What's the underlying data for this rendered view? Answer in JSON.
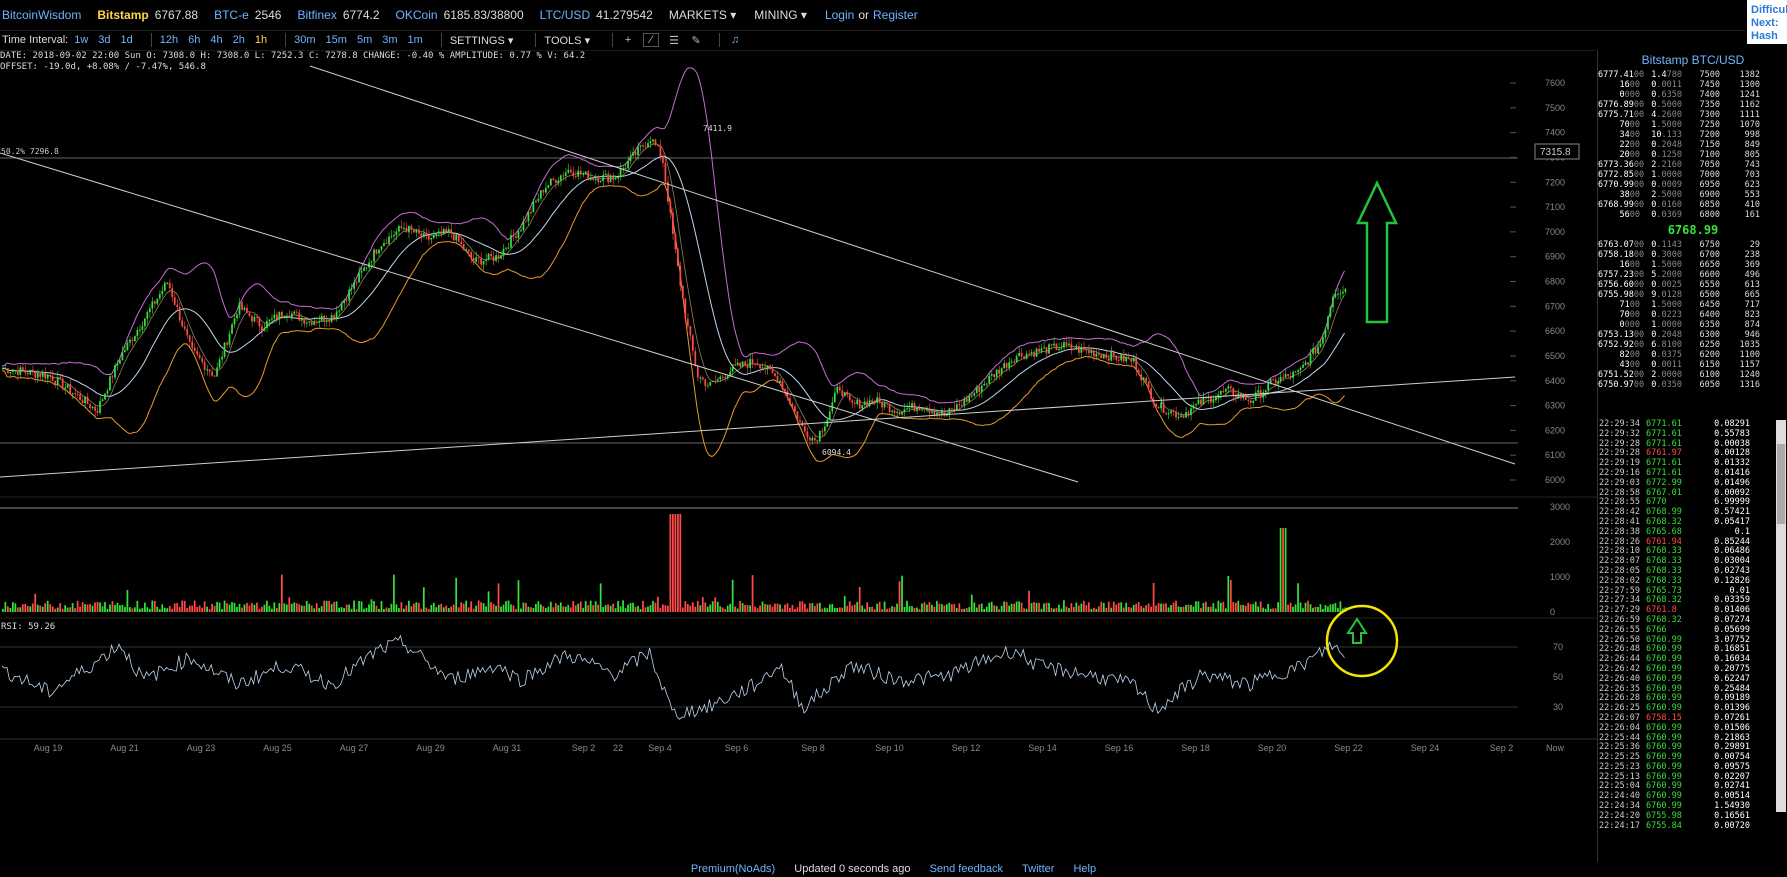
{
  "topbar": {
    "logo": "BitcoinWisdom",
    "exchanges": [
      {
        "name": "Bitstamp",
        "price": "6767.88",
        "active": true
      },
      {
        "name": "BTC-e",
        "price": "2546",
        "active": false
      },
      {
        "name": "Bitfinex",
        "price": "6774.2",
        "active": false
      },
      {
        "name": "OKCoin",
        "price": "6185.83/38800",
        "active": false
      },
      {
        "name": "LTC/USD",
        "price": "41.279542",
        "active": false
      }
    ],
    "markets_label": "MARKETS",
    "mining_label": "MINING",
    "login_label": "Login",
    "or_label": "or",
    "register_label": "Register",
    "difficulty_lines": [
      "Difficul",
      "Next:",
      "Hash R"
    ]
  },
  "toolbar": {
    "interval_label": "Time Interval:",
    "intervals": [
      "1w",
      "3d",
      "1d",
      "12h",
      "6h",
      "4h",
      "2h",
      "1h",
      "30m",
      "15m",
      "5m",
      "3m",
      "1m"
    ],
    "active_interval": "1h",
    "settings_label": "SETTINGS",
    "tools_label": "TOOLS"
  },
  "ohlc": {
    "line1": "DATE: 2018-09-02 22:00 Sun    O: 7308.0    H: 7308.0    L: 7252.3    C: 7278.8    CHANGE: -0.40 %    AMPLITUDE: 0.77 %    V: 64.2",
    "line2": "OFFSET: -19.0d, +8.08% / -7.47%, 546.8"
  },
  "chart_data": {
    "type": "candlestick",
    "pair": "Bitstamp BTC/USD",
    "price_axis": {
      "min": 6000,
      "max": 7600,
      "ticks": [
        "7600",
        "7500",
        "7400",
        "7300",
        "7200",
        "7100",
        "7000",
        "6900",
        "6800",
        "6700",
        "6600",
        "6500",
        "6400",
        "6300",
        "6200",
        "6100",
        "6000"
      ]
    },
    "volume_axis": {
      "ticks": [
        "3000",
        "2000",
        "1000",
        "0"
      ]
    },
    "rsi_axis": {
      "ticks": [
        "70",
        "50",
        "30"
      ]
    },
    "rsi_label": "RSI: 59.26",
    "x_labels": [
      "Aug 19",
      "Aug 21",
      "Aug 23",
      "Aug 25",
      "Aug 27",
      "Aug 29",
      "Aug 31",
      "Sep 2",
      "22",
      "Sep 4",
      "Sep 6",
      "Sep 8",
      "Sep 10",
      "Sep 12",
      "Sep 14",
      "Sep 16",
      "Sep 18",
      "Sep 20",
      "Sep 22",
      "Sep 24",
      "Sep 2",
      "Now"
    ],
    "current_price_tag": "7315.8",
    "left_level_label": "50.2% 7296.8",
    "high_label": "7411.9",
    "low_label": "6094.4",
    "close_keypoints": [
      {
        "t": 0,
        "p": 6450
      },
      {
        "t": 4,
        "p": 6420
      },
      {
        "t": 8,
        "p": 6280
      },
      {
        "t": 10,
        "p": 6500
      },
      {
        "t": 12,
        "p": 6650
      },
      {
        "t": 14,
        "p": 6800
      },
      {
        "t": 16,
        "p": 6520
      },
      {
        "t": 18,
        "p": 6420
      },
      {
        "t": 20,
        "p": 6700
      },
      {
        "t": 22,
        "p": 6620
      },
      {
        "t": 24,
        "p": 6680
      },
      {
        "t": 26,
        "p": 6640
      },
      {
        "t": 28,
        "p": 6660
      },
      {
        "t": 30,
        "p": 6800
      },
      {
        "t": 32,
        "p": 6950
      },
      {
        "t": 34,
        "p": 7020
      },
      {
        "t": 36,
        "p": 6970
      },
      {
        "t": 38,
        "p": 7000
      },
      {
        "t": 40,
        "p": 6880
      },
      {
        "t": 42,
        "p": 6900
      },
      {
        "t": 44,
        "p": 7020
      },
      {
        "t": 46,
        "p": 7180
      },
      {
        "t": 48,
        "p": 7250
      },
      {
        "t": 50,
        "p": 7220
      },
      {
        "t": 52,
        "p": 7220
      },
      {
        "t": 54,
        "p": 7330
      },
      {
        "t": 55,
        "p": 7380
      },
      {
        "t": 56,
        "p": 7300
      },
      {
        "t": 57,
        "p": 6950
      },
      {
        "t": 58,
        "p": 6650
      },
      {
        "t": 59,
        "p": 6420
      },
      {
        "t": 60,
        "p": 6380
      },
      {
        "t": 62,
        "p": 6450
      },
      {
        "t": 64,
        "p": 6480
      },
      {
        "t": 66,
        "p": 6400
      },
      {
        "t": 68,
        "p": 6200
      },
      {
        "t": 69,
        "p": 6160
      },
      {
        "t": 70,
        "p": 6250
      },
      {
        "t": 71,
        "p": 6380
      },
      {
        "t": 72,
        "p": 6300
      },
      {
        "t": 74,
        "p": 6320
      },
      {
        "t": 76,
        "p": 6280
      },
      {
        "t": 78,
        "p": 6300
      },
      {
        "t": 80,
        "p": 6260
      },
      {
        "t": 82,
        "p": 6330
      },
      {
        "t": 84,
        "p": 6420
      },
      {
        "t": 86,
        "p": 6500
      },
      {
        "t": 88,
        "p": 6520
      },
      {
        "t": 90,
        "p": 6540
      },
      {
        "t": 92,
        "p": 6520
      },
      {
        "t": 94,
        "p": 6500
      },
      {
        "t": 96,
        "p": 6480
      },
      {
        "t": 98,
        "p": 6300
      },
      {
        "t": 100,
        "p": 6260
      },
      {
        "t": 102,
        "p": 6320
      },
      {
        "t": 104,
        "p": 6360
      },
      {
        "t": 106,
        "p": 6320
      },
      {
        "t": 108,
        "p": 6400
      },
      {
        "t": 110,
        "p": 6430
      },
      {
        "t": 112,
        "p": 6560
      },
      {
        "t": 113,
        "p": 6760
      },
      {
        "t": 114,
        "p": 6770
      }
    ],
    "rsi_keypoints": [
      {
        "t": 0,
        "v": 55
      },
      {
        "t": 4,
        "v": 40
      },
      {
        "t": 8,
        "v": 60
      },
      {
        "t": 10,
        "v": 72
      },
      {
        "t": 12,
        "v": 48
      },
      {
        "t": 16,
        "v": 63
      },
      {
        "t": 20,
        "v": 45
      },
      {
        "t": 24,
        "v": 58
      },
      {
        "t": 28,
        "v": 45
      },
      {
        "t": 32,
        "v": 68
      },
      {
        "t": 34,
        "v": 73
      },
      {
        "t": 38,
        "v": 48
      },
      {
        "t": 42,
        "v": 58
      },
      {
        "t": 44,
        "v": 48
      },
      {
        "t": 48,
        "v": 65
      },
      {
        "t": 52,
        "v": 52
      },
      {
        "t": 55,
        "v": 66
      },
      {
        "t": 57,
        "v": 25
      },
      {
        "t": 60,
        "v": 30
      },
      {
        "t": 64,
        "v": 45
      },
      {
        "t": 66,
        "v": 58
      },
      {
        "t": 68,
        "v": 30
      },
      {
        "t": 70,
        "v": 42
      },
      {
        "t": 72,
        "v": 58
      },
      {
        "t": 76,
        "v": 48
      },
      {
        "t": 80,
        "v": 50
      },
      {
        "t": 84,
        "v": 63
      },
      {
        "t": 86,
        "v": 68
      },
      {
        "t": 88,
        "v": 57
      },
      {
        "t": 92,
        "v": 52
      },
      {
        "t": 96,
        "v": 45
      },
      {
        "t": 98,
        "v": 28
      },
      {
        "t": 100,
        "v": 40
      },
      {
        "t": 102,
        "v": 52
      },
      {
        "t": 104,
        "v": 48
      },
      {
        "t": 106,
        "v": 45
      },
      {
        "t": 108,
        "v": 52
      },
      {
        "t": 110,
        "v": 56
      },
      {
        "t": 112,
        "v": 66
      },
      {
        "t": 113,
        "v": 72
      },
      {
        "t": 114,
        "v": 62
      }
    ]
  },
  "orderbook": {
    "title": "Bitstamp BTC/USD",
    "asks": [
      {
        "price_main": "6777.41",
        "price_dim": "00",
        "amt_main": "1.4",
        "amt_dim": "780",
        "cum_price": "7500",
        "cum_amt": "1382"
      },
      {
        "price_main": "16",
        "price_dim": "00",
        "amt_main": "0",
        "amt_dim": ".0011",
        "cum_price": "7450",
        "cum_amt": "1300"
      },
      {
        "price_main": "0",
        "price_dim": "000",
        "amt_main": "0",
        "amt_dim": ".6350",
        "cum_price": "7400",
        "cum_amt": "1241"
      },
      {
        "price_main": "6776.89",
        "price_dim": "00",
        "amt_main": "0",
        "amt_dim": ".5000",
        "cum_price": "7350",
        "cum_amt": "1162"
      },
      {
        "price_main": "6775.71",
        "price_dim": "00",
        "amt_main": "4",
        "amt_dim": ".2600",
        "cum_price": "7300",
        "cum_amt": "1111"
      },
      {
        "price_main": "70",
        "price_dim": "00",
        "amt_main": "1",
        "amt_dim": ".5000",
        "cum_price": "7250",
        "cum_amt": "1070"
      },
      {
        "price_main": "34",
        "price_dim": "00",
        "amt_main": "10",
        "amt_dim": ".133",
        "cum_price": "7200",
        "cum_amt": "998"
      },
      {
        "price_main": "22",
        "price_dim": "00",
        "amt_main": "0",
        "amt_dim": ".2048",
        "cum_price": "7150",
        "cum_amt": "849"
      },
      {
        "price_main": "20",
        "price_dim": "00",
        "amt_main": "0",
        "amt_dim": ".1250",
        "cum_price": "7100",
        "cum_amt": "805"
      },
      {
        "price_main": "6773.36",
        "price_dim": "00",
        "amt_main": "2",
        "amt_dim": ".2160",
        "cum_price": "7050",
        "cum_amt": "743"
      },
      {
        "price_main": "6772.85",
        "price_dim": "00",
        "amt_main": "1",
        "amt_dim": ".0000",
        "cum_price": "7000",
        "cum_amt": "703"
      },
      {
        "price_main": "6770.99",
        "price_dim": "00",
        "amt_main": "0",
        "amt_dim": ".0009",
        "cum_price": "6950",
        "cum_amt": "623"
      },
      {
        "price_main": "38",
        "price_dim": "00",
        "amt_main": "2",
        "amt_dim": ".5000",
        "cum_price": "6900",
        "cum_amt": "553"
      },
      {
        "price_main": "6768.99",
        "price_dim": "00",
        "amt_main": "0",
        "amt_dim": ".0160",
        "cum_price": "6850",
        "cum_amt": "410"
      },
      {
        "price_main": "56",
        "price_dim": "00",
        "amt_main": "0",
        "amt_dim": ".0369",
        "cum_price": "6800",
        "cum_amt": "161"
      }
    ],
    "mid_price": "6768.99",
    "bids": [
      {
        "price_main": "6763.07",
        "price_dim": "00",
        "amt_main": "0",
        "amt_dim": ".1143",
        "cum_price": "6750",
        "cum_amt": "29"
      },
      {
        "price_main": "6758.18",
        "price_dim": "00",
        "amt_main": "0",
        "amt_dim": ".3000",
        "cum_price": "6700",
        "cum_amt": "238"
      },
      {
        "price_main": "16",
        "price_dim": "00",
        "amt_main": "1",
        "amt_dim": ".5000",
        "cum_price": "6650",
        "cum_amt": "369"
      },
      {
        "price_main": "6757.23",
        "price_dim": "00",
        "amt_main": "5",
        "amt_dim": ".2000",
        "cum_price": "6600",
        "cum_amt": "496"
      },
      {
        "price_main": "6756.60",
        "price_dim": "00",
        "amt_main": "0",
        "amt_dim": ".0025",
        "cum_price": "6550",
        "cum_amt": "613"
      },
      {
        "price_main": "6755.98",
        "price_dim": "00",
        "amt_main": "9",
        "amt_dim": ".0128",
        "cum_price": "6500",
        "cum_amt": "665"
      },
      {
        "price_main": "71",
        "price_dim": "00",
        "amt_main": "1",
        "amt_dim": ".5000",
        "cum_price": "6450",
        "cum_amt": "717"
      },
      {
        "price_main": "70",
        "price_dim": "00",
        "amt_main": "0",
        "amt_dim": ".0223",
        "cum_price": "6400",
        "cum_amt": "823"
      },
      {
        "price_main": "0",
        "price_dim": "000",
        "amt_main": "1",
        "amt_dim": ".0000",
        "cum_price": "6350",
        "cum_amt": "874"
      },
      {
        "price_main": "6753.13",
        "price_dim": "00",
        "amt_main": "0",
        "amt_dim": ".2048",
        "cum_price": "6300",
        "cum_amt": "946"
      },
      {
        "price_main": "6752.92",
        "price_dim": "00",
        "amt_main": "6",
        "amt_dim": ".8100",
        "cum_price": "6250",
        "cum_amt": "1035"
      },
      {
        "price_main": "82",
        "price_dim": "00",
        "amt_main": "0",
        "amt_dim": ".0375",
        "cum_price": "6200",
        "cum_amt": "1100"
      },
      {
        "price_main": "43",
        "price_dim": "00",
        "amt_main": "0",
        "amt_dim": ".0011",
        "cum_price": "6150",
        "cum_amt": "1157"
      },
      {
        "price_main": "6751.52",
        "price_dim": "00",
        "amt_main": "2",
        "amt_dim": ".0000",
        "cum_price": "6100",
        "cum_amt": "1240"
      },
      {
        "price_main": "6750.97",
        "price_dim": "00",
        "amt_main": "0",
        "amt_dim": ".0350",
        "cum_price": "6050",
        "cum_amt": "1316"
      }
    ]
  },
  "trades": [
    {
      "time": "22:29:34",
      "price": "6771.61",
      "dir": "up",
      "amount": "0.08291"
    },
    {
      "time": "22:29:32",
      "price": "6771.61",
      "dir": "up",
      "amount": "0.55783"
    },
    {
      "time": "22:29:28",
      "price": "6771.61",
      "dir": "up",
      "amount": "0.00038"
    },
    {
      "time": "22:29:28",
      "price": "6761.97",
      "dir": "dn",
      "amount": "0.00128"
    },
    {
      "time": "22:29:19",
      "price": "6771.61",
      "dir": "up",
      "amount": "0.01332"
    },
    {
      "time": "22:29:16",
      "price": "6771.61",
      "dir": "up",
      "amount": "0.01416"
    },
    {
      "time": "22:29:03",
      "price": "6772.99",
      "dir": "up",
      "amount": "0.01496"
    },
    {
      "time": "22:28:58",
      "price": "6767.01",
      "dir": "up",
      "amount": "0.00092"
    },
    {
      "time": "22:28:55",
      "price": "6770",
      "dir": "up",
      "amount": "6.99999"
    },
    {
      "time": "22:28:42",
      "price": "6768.99",
      "dir": "up",
      "amount": "0.57421"
    },
    {
      "time": "22:28:41",
      "price": "6768.32",
      "dir": "up",
      "amount": "0.05417"
    },
    {
      "time": "22:28:38",
      "price": "6765.68",
      "dir": "up",
      "amount": "0.1"
    },
    {
      "time": "22:28:26",
      "price": "6761.94",
      "dir": "dn",
      "amount": "0.85244"
    },
    {
      "time": "22:28:10",
      "price": "6768.33",
      "dir": "up",
      "amount": "0.06486"
    },
    {
      "time": "22:28:07",
      "price": "6768.33",
      "dir": "up",
      "amount": "0.03004"
    },
    {
      "time": "22:28:05",
      "price": "6768.33",
      "dir": "up",
      "amount": "0.02743"
    },
    {
      "time": "22:28:02",
      "price": "6768.33",
      "dir": "up",
      "amount": "0.12826"
    },
    {
      "time": "22:27:59",
      "price": "6765.73",
      "dir": "up",
      "amount": "0.01"
    },
    {
      "time": "22:27:34",
      "price": "6768.32",
      "dir": "up",
      "amount": "0.03359"
    },
    {
      "time": "22:27:29",
      "price": "6761.8",
      "dir": "dn",
      "amount": "0.01406"
    },
    {
      "time": "22:26:59",
      "price": "6768.32",
      "dir": "up",
      "amount": "0.07274"
    },
    {
      "time": "22:26:55",
      "price": "6766",
      "dir": "up",
      "amount": "0.05699"
    },
    {
      "time": "22:26:50",
      "price": "6760.99",
      "dir": "up",
      "amount": "3.07752"
    },
    {
      "time": "22:26:48",
      "price": "6760.99",
      "dir": "up",
      "amount": "0.16851"
    },
    {
      "time": "22:26:44",
      "price": "6760.99",
      "dir": "up",
      "amount": "0.16034"
    },
    {
      "time": "22:26:42",
      "price": "6760.99",
      "dir": "up",
      "amount": "0.20775"
    },
    {
      "time": "22:26:40",
      "price": "6760.99",
      "dir": "up",
      "amount": "0.62247"
    },
    {
      "time": "22:26:35",
      "price": "6760.99",
      "dir": "up",
      "amount": "0.25484"
    },
    {
      "time": "22:26:28",
      "price": "6760.99",
      "dir": "up",
      "amount": "0.09189"
    },
    {
      "time": "22:26:25",
      "price": "6760.99",
      "dir": "up",
      "amount": "0.01396"
    },
    {
      "time": "22:26:07",
      "price": "6758.15",
      "dir": "dn",
      "amount": "0.07261"
    },
    {
      "time": "22:26:04",
      "price": "6760.99",
      "dir": "up",
      "amount": "0.01506"
    },
    {
      "time": "22:25:44",
      "price": "6760.99",
      "dir": "up",
      "amount": "0.21863"
    },
    {
      "time": "22:25:36",
      "price": "6760.99",
      "dir": "up",
      "amount": "0.29891"
    },
    {
      "time": "22:25:25",
      "price": "6760.99",
      "dir": "up",
      "amount": "0.00754"
    },
    {
      "time": "22:25:23",
      "price": "6760.99",
      "dir": "up",
      "amount": "0.09575"
    },
    {
      "time": "22:25:13",
      "price": "6760.99",
      "dir": "up",
      "amount": "0.02207"
    },
    {
      "time": "22:25:04",
      "price": "6760.99",
      "dir": "up",
      "amount": "0.02741"
    },
    {
      "time": "22:24:40",
      "price": "6760.99",
      "dir": "up",
      "amount": "0.00514"
    },
    {
      "time": "22:24:34",
      "price": "6760.99",
      "dir": "up",
      "amount": "1.54930"
    },
    {
      "time": "22:24:20",
      "price": "6755.98",
      "dir": "up",
      "amount": "0.16561"
    },
    {
      "time": "22:24:17",
      "price": "6755.84",
      "dir": "up",
      "amount": "0.00720"
    }
  ],
  "footer": {
    "premium": "Premium(NoAds)",
    "updated": "Updated 0 seconds ago",
    "feedback": "Send feedback",
    "twitter": "Twitter",
    "help": "Help"
  },
  "colors": {
    "up": "#37e03a",
    "down": "#ff4a4a",
    "accent": "#6fb4ff",
    "highlight": "#ffd54a",
    "annotation_arrow": "#21c43a",
    "annotation_circle": "#f5e400"
  }
}
